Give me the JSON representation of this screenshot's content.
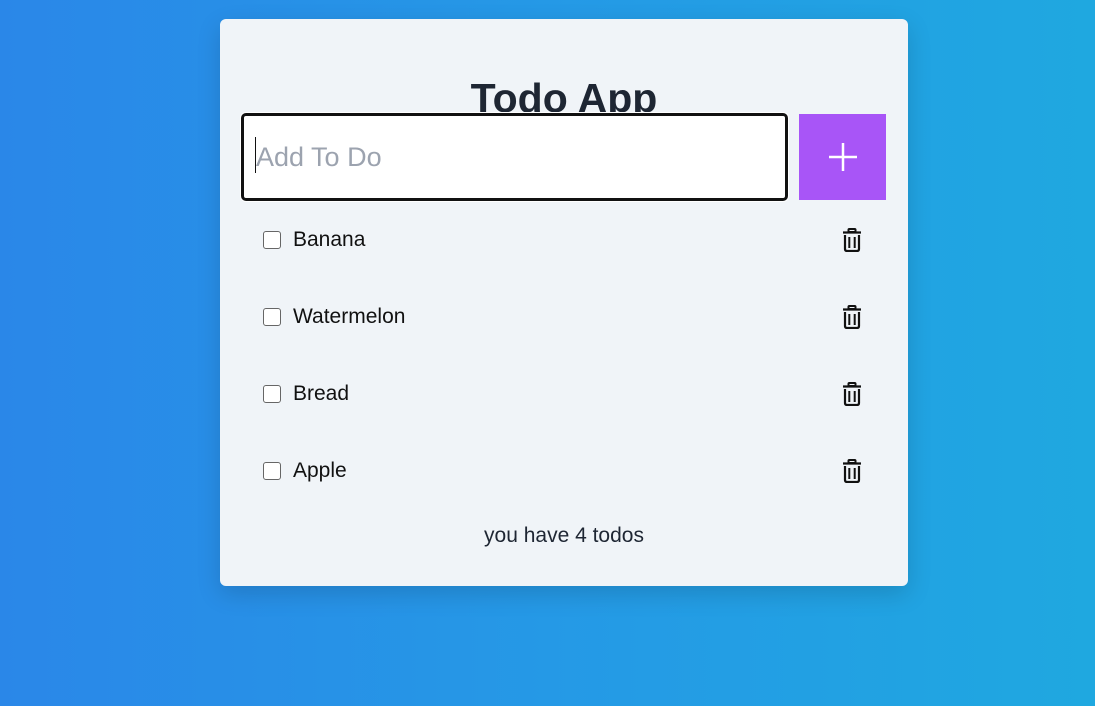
{
  "app": {
    "title": "Todo App"
  },
  "input": {
    "placeholder": "Add To Do",
    "value": ""
  },
  "add_button": {
    "icon": "plus-icon",
    "color": "#a855f7"
  },
  "todos": [
    {
      "label": "Banana",
      "checked": false,
      "delete_icon": "trash-icon"
    },
    {
      "label": "Watermelon",
      "checked": false,
      "delete_icon": "trash-icon"
    },
    {
      "label": "Bread",
      "checked": false,
      "delete_icon": "trash-icon"
    },
    {
      "label": "Apple",
      "checked": false,
      "delete_icon": "trash-icon"
    }
  ],
  "footer": {
    "count_text": "you have 4 todos"
  },
  "colors": {
    "background_start": "#2a87e8",
    "background_end": "#1fa8e0",
    "card": "#f0f4f8",
    "accent": "#a855f7",
    "text": "#1e2633"
  }
}
